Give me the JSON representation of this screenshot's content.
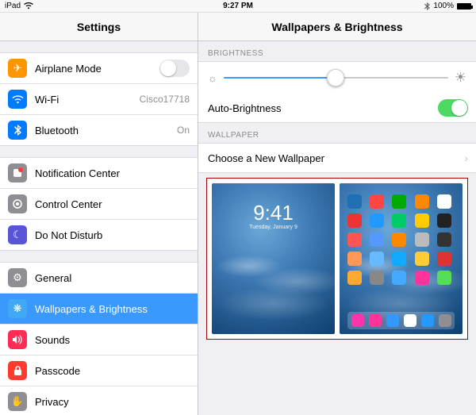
{
  "statusbar": {
    "device": "iPad",
    "time": "9:27 PM",
    "battery_pct": "100%"
  },
  "sidebar": {
    "title": "Settings",
    "group1": [
      {
        "label": "Airplane Mode",
        "kind": "switch",
        "on": false,
        "icon_bg": "#ff9500",
        "icon_name": "airplane-icon"
      },
      {
        "label": "Wi-Fi",
        "value": "Cisco17718",
        "icon_bg": "#007aff",
        "icon_name": "wifi-icon"
      },
      {
        "label": "Bluetooth",
        "value": "On",
        "icon_bg": "#007aff",
        "icon_name": "bluetooth-icon"
      }
    ],
    "group2": [
      {
        "label": "Notification Center",
        "icon_bg": "#8e8e93",
        "icon_name": "notification-icon"
      },
      {
        "label": "Control Center",
        "icon_bg": "#8e8e93",
        "icon_name": "control-center-icon"
      },
      {
        "label": "Do Not Disturb",
        "icon_bg": "#5856d6",
        "icon_name": "moon-icon"
      }
    ],
    "group3": [
      {
        "label": "General",
        "icon_bg": "#8e8e93",
        "icon_name": "gear-icon"
      },
      {
        "label": "Wallpapers & Brightness",
        "icon_bg": "#41a8f4",
        "icon_name": "brightness-atom-icon",
        "selected": true
      },
      {
        "label": "Sounds",
        "icon_bg": "#ff2d55",
        "icon_name": "speaker-icon"
      },
      {
        "label": "Passcode",
        "icon_bg": "#ff3b30",
        "icon_name": "lock-icon"
      },
      {
        "label": "Privacy",
        "icon_bg": "#8e8e93",
        "icon_name": "hand-icon"
      }
    ]
  },
  "detail": {
    "title": "Wallpapers & Brightness",
    "sections": {
      "brightness": {
        "header": "BRIGHTNESS",
        "slider_value_pct": 50,
        "auto_label": "Auto-Brightness",
        "auto_on": true
      },
      "wallpaper": {
        "header": "WALLPAPER",
        "choose_label": "Choose a New Wallpaper",
        "lock_preview": {
          "time": "9:41",
          "date": "Tuesday, January 9"
        }
      }
    }
  },
  "icon_glyphs": {
    "airplane-icon": "✈",
    "wifi-icon": "wifi-svg",
    "bluetooth-icon": "bt-svg",
    "notification-icon": "■",
    "control-center-icon": "◉",
    "moon-icon": "☾",
    "gear-icon": "⚙",
    "brightness-atom-icon": "❋",
    "speaker-icon": "🔊",
    "lock-icon": "🔒",
    "hand-icon": "✋"
  },
  "colors": {
    "selected_bg": "#3a99fc",
    "switch_on": "#4cd964"
  }
}
